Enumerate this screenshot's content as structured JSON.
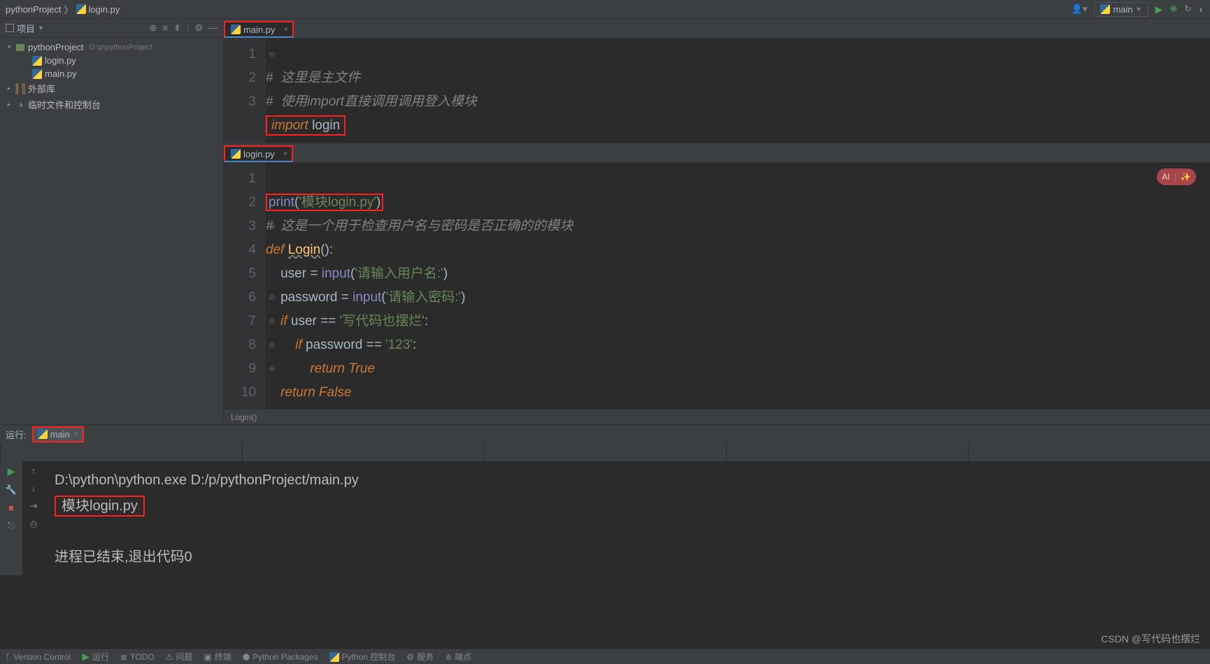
{
  "breadcrumb": {
    "root": "pythonProject",
    "file": "login.py"
  },
  "run_config": {
    "label": "main"
  },
  "sidebar": {
    "title": "项目",
    "tree": {
      "project": "pythonProject",
      "project_hint": "D:\\p\\pythonProject",
      "file_login": "login.py",
      "file_main": "main.py",
      "ext_lib": "外部库",
      "scratch": "临时文件和控制台"
    }
  },
  "editor_main": {
    "tab": "main.py",
    "lines": {
      "l1": "#  这里是主文件",
      "l2_a": "#  使用",
      "l2_b": "import",
      "l2_c": "直接调用调用登入模块",
      "l3_kw": "import",
      "l3_id": " login"
    }
  },
  "editor_login": {
    "tab": "login.py",
    "lines": {
      "l1_fn": "print",
      "l1_p1": "(",
      "l1_s": "'模块login.py'",
      "l1_p2": ")",
      "l2": "#  这是一个用于检查用户名与密码是否正确的的模块",
      "l3_def": "def ",
      "l3_name": "Login",
      "l3_sig": "():",
      "l4_a": "    user = ",
      "l4_fn": "input",
      "l4_p1": "(",
      "l4_s": "'请输入用户名:'",
      "l4_p2": ")",
      "l5_a": "    password = ",
      "l5_fn": "input",
      "l5_p1": "(",
      "l5_s": "'请输入密码:'",
      "l5_p2": ")",
      "l6_a": "    ",
      "l6_if": "if",
      "l6_b": " user == ",
      "l6_s": "'写代码也摆烂'",
      "l6_c": ":",
      "l7_a": "        ",
      "l7_if": "if",
      "l7_b": " password == ",
      "l7_s": "'123'",
      "l7_c": ":",
      "l8_a": "            ",
      "l8_ret": "return ",
      "l8_val": "True",
      "l9_a": "    ",
      "l9_ret": "return ",
      "l9_val": "False"
    },
    "crumb": "Login()"
  },
  "run": {
    "label": "运行:",
    "tab": "main",
    "out1": "D:\\python\\python.exe D:/p/pythonProject/main.py",
    "out2": "模块login.py",
    "out3": "进程已结束,退出代码0"
  },
  "status": {
    "vc": "Version Control",
    "run": "运行",
    "todo": "TODO",
    "problems": "问题",
    "terminal": "终端",
    "pkg": "Python Packages",
    "console": "Python 控制台",
    "services": "服务",
    "endpoint": "端点"
  },
  "watermark": "CSDN @写代码也摆烂"
}
